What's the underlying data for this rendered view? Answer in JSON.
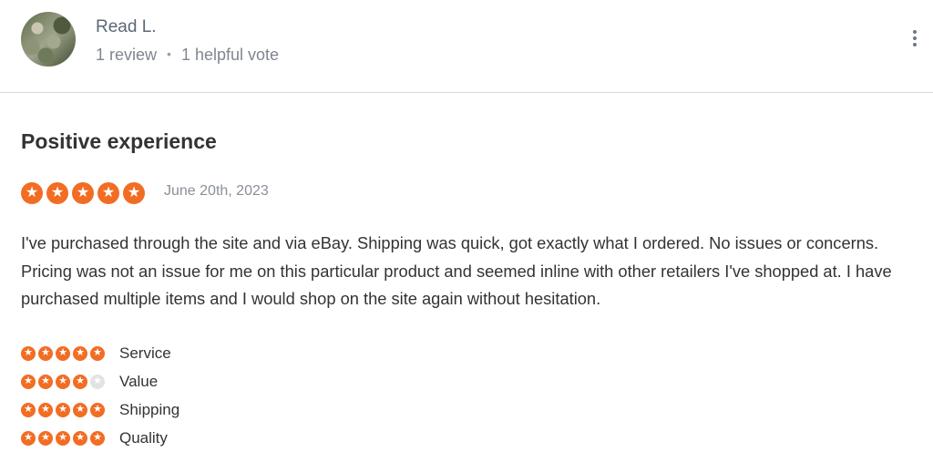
{
  "reviewer": {
    "name": "Read L.",
    "review_count": "1 review",
    "separator": "•",
    "helpful_votes": "1 helpful vote",
    "more_icon": "kebab-menu-icon"
  },
  "review": {
    "title": "Positive experience",
    "rating": 5,
    "max_rating": 5,
    "date": "June 20th, 2023",
    "text": "I've purchased through the site and via eBay. Shipping was quick, got exactly what I ordered. No issues or concerns. Pricing was not an issue for me on this particular product and seemed inline with other retailers I've shopped at. I have purchased multiple items and I would shop on the site again without hesitation."
  },
  "sub_ratings": [
    {
      "label": "Service",
      "rating": 5
    },
    {
      "label": "Value",
      "rating": 4
    },
    {
      "label": "Shipping",
      "rating": 5
    },
    {
      "label": "Quality",
      "rating": 5
    }
  ],
  "colors": {
    "star_filled": "#f26d24",
    "star_empty": "#e3e3e3"
  }
}
